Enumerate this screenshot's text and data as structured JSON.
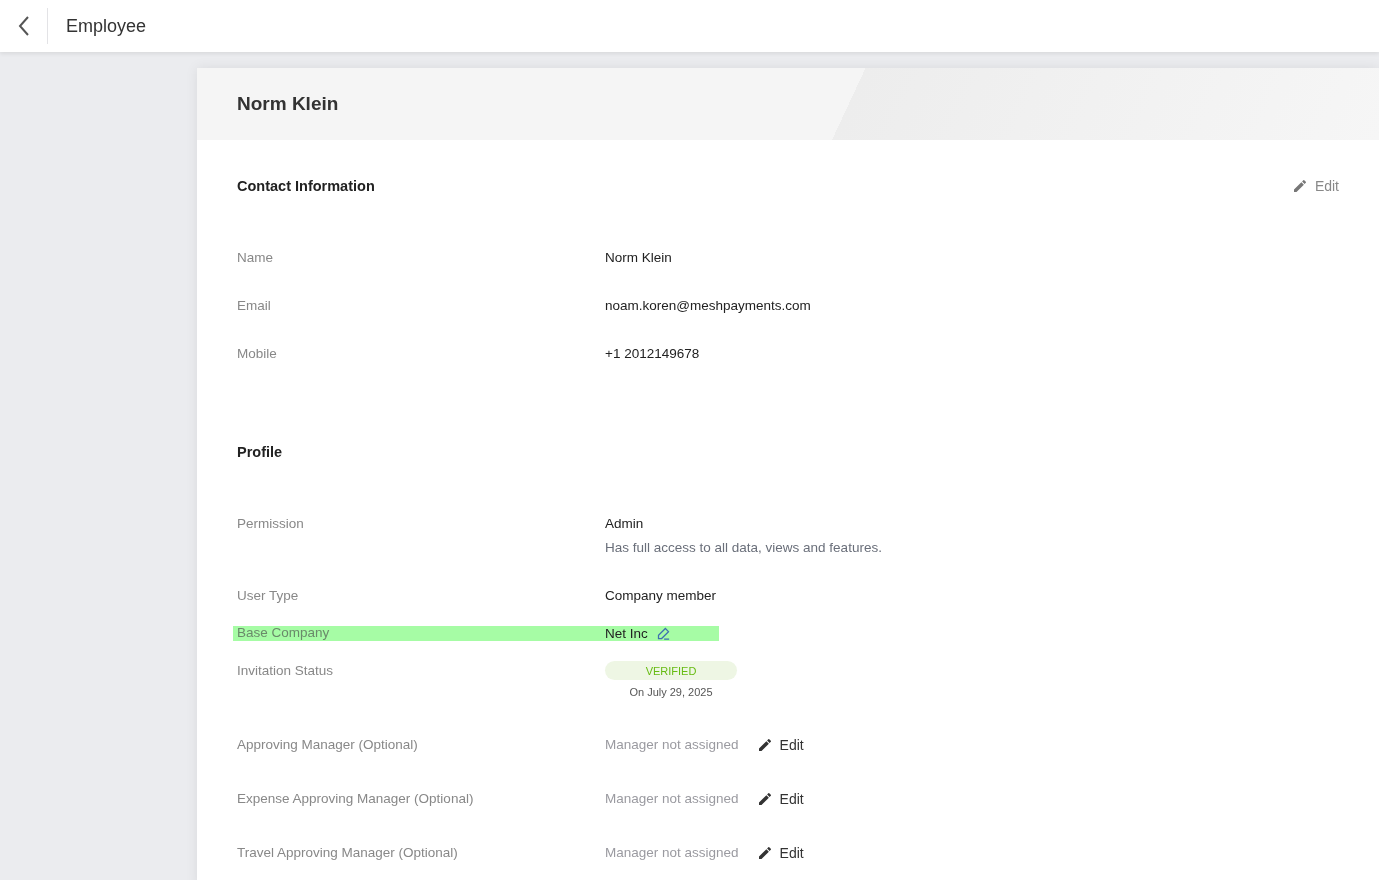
{
  "header": {
    "title": "Employee"
  },
  "card": {
    "title": "Norm Klein",
    "sections": [
      {
        "title": "Contact Information",
        "edit": "Edit",
        "rows": [
          {
            "kind": "text",
            "label": "Name",
            "value": "Norm Klein"
          },
          {
            "kind": "text",
            "label": "Email",
            "value": "noam.koren@meshpayments.com"
          },
          {
            "kind": "text",
            "label": "Mobile",
            "value": "+1 2012149678"
          }
        ]
      },
      {
        "title": "Profile",
        "rows": [
          {
            "kind": "described",
            "label": "Permission",
            "value": "Admin",
            "description": "Has full access to all data, views and features."
          },
          {
            "kind": "text",
            "label": "User Type",
            "value": "Company member"
          },
          {
            "kind": "company",
            "label": "Base Company",
            "value": "Net Inc",
            "highlighted": true
          },
          {
            "kind": "status",
            "label": "Invitation Status",
            "badge": "VERIFIED",
            "date": "On July 29, 2025"
          },
          {
            "kind": "manager",
            "label": "Approving Manager (Optional)",
            "note": "Manager not assigned",
            "edit": "Edit"
          },
          {
            "kind": "manager",
            "label": "Expense Approving Manager (Optional)",
            "note": "Manager not assigned",
            "edit": "Edit"
          },
          {
            "kind": "manager",
            "label": "Travel Approving Manager (Optional)",
            "note": "Manager not assigned",
            "edit": "Edit"
          }
        ]
      }
    ]
  }
}
